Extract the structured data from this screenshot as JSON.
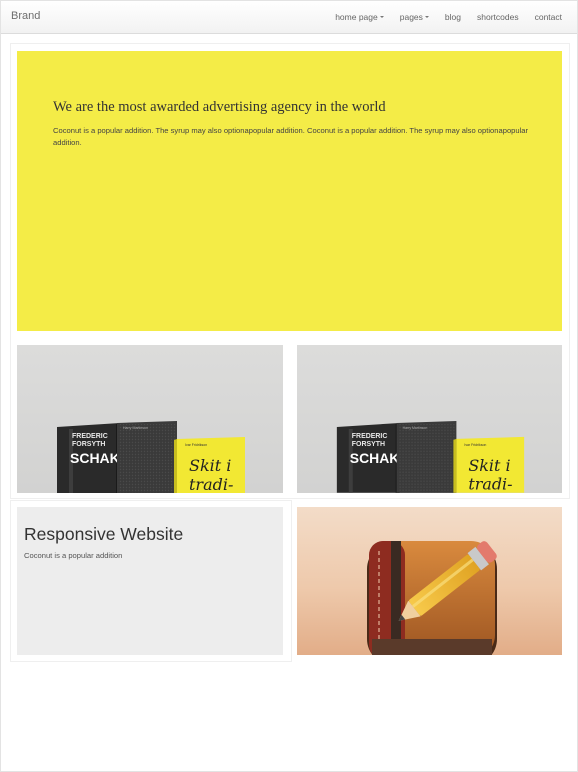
{
  "navbar": {
    "brand": "Brand",
    "items": [
      {
        "label": "home page",
        "dropdown": true
      },
      {
        "label": "pages",
        "dropdown": true
      },
      {
        "label": "blog",
        "dropdown": false
      },
      {
        "label": "shortcodes",
        "dropdown": false
      },
      {
        "label": "contact",
        "dropdown": false
      }
    ]
  },
  "hero": {
    "title": "We are the most awarded advertising agency in the world",
    "text": "Coconut is a popular addition. The syrup may also optionapopular addition. Coconut is a popular addition. The syrup may also optionapopular addition.",
    "background": "#f4ec47"
  },
  "tiles": {
    "books_left": {
      "image": "book-covers-image"
    },
    "books_right": {
      "image": "book-covers-image"
    },
    "responsive": {
      "title": "Responsive Website",
      "text": "Coconut is a popular addition",
      "background": "#ededed"
    },
    "notebook": {
      "image": "notebook-pencil-icon"
    }
  },
  "colors": {
    "accent_yellow": "#f4ec47",
    "text_dark": "#333333",
    "navbar_bg": "#f7f7f7"
  }
}
